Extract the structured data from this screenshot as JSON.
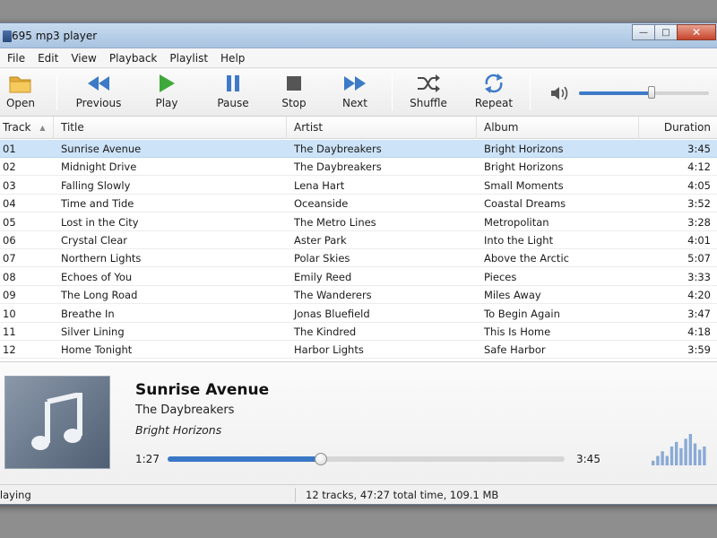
{
  "window": {
    "title": "695 mp3 player"
  },
  "menu": [
    "File",
    "Edit",
    "View",
    "Playback",
    "Playlist",
    "Help"
  ],
  "toolbar": {
    "buttons": [
      {
        "label": "Open",
        "icon": "folder-icon"
      },
      {
        "label": "Previous",
        "icon": "previous-icon"
      },
      {
        "label": "Play",
        "icon": "play-icon"
      },
      {
        "label": "Pause",
        "icon": "pause-icon"
      },
      {
        "label": "Stop",
        "icon": "stop-icon"
      },
      {
        "label": "Next",
        "icon": "next-icon"
      },
      {
        "label": "Shuffle",
        "icon": "shuffle-icon"
      },
      {
        "label": "Repeat",
        "icon": "repeat-icon"
      }
    ],
    "volume_level": 0.56,
    "accent_color": "#3d7ac8",
    "play_color": "#3fa83b"
  },
  "playlist": {
    "columns": [
      "Track",
      "Title",
      "Artist",
      "Album",
      "Duration"
    ],
    "sorted_column": "Track",
    "selected_index": 0,
    "rows": [
      [
        "01",
        "Sunrise Avenue",
        "The Daybreakers",
        "Bright Horizons",
        "3:45"
      ],
      [
        "02",
        "Midnight Drive",
        "The Daybreakers",
        "Bright Horizons",
        "4:12"
      ],
      [
        "03",
        "Falling Slowly",
        "Lena Hart",
        "Small Moments",
        "4:05"
      ],
      [
        "04",
        "Time and Tide",
        "Oceanside",
        "Coastal Dreams",
        "3:52"
      ],
      [
        "05",
        "Lost in the City",
        "The Metro Lines",
        "Metropolitan",
        "3:28"
      ],
      [
        "06",
        "Crystal Clear",
        "Aster Park",
        "Into the Light",
        "4:01"
      ],
      [
        "07",
        "Northern Lights",
        "Polar Skies",
        "Above the Arctic",
        "5:07"
      ],
      [
        "08",
        "Echoes of You",
        "Emily Reed",
        "Pieces",
        "3:33"
      ],
      [
        "09",
        "The Long Road",
        "The Wanderers",
        "Miles Away",
        "4:20"
      ],
      [
        "10",
        "Breathe In",
        "Jonas Bluefield",
        "To Begin Again",
        "3:47"
      ],
      [
        "11",
        "Silver Lining",
        "The Kindred",
        "This Is Home",
        "4:18"
      ],
      [
        "12",
        "Home Tonight",
        "Harbor Lights",
        "Safe Harbor",
        "3:59"
      ]
    ]
  },
  "now_playing": {
    "title": "Sunrise Avenue",
    "artist": "The Daybreakers",
    "album": "Bright Horizons",
    "elapsed": "1:27",
    "total": "3:45",
    "progress": 0.387,
    "spectrum_levels": [
      0.15,
      0.3,
      0.45,
      0.3,
      0.6,
      0.75,
      0.55,
      0.85,
      1.0,
      0.7,
      0.5,
      0.6
    ]
  },
  "status": {
    "state": "Playing",
    "summary": "12 tracks, 47:27 total time, 109.1 MB"
  }
}
